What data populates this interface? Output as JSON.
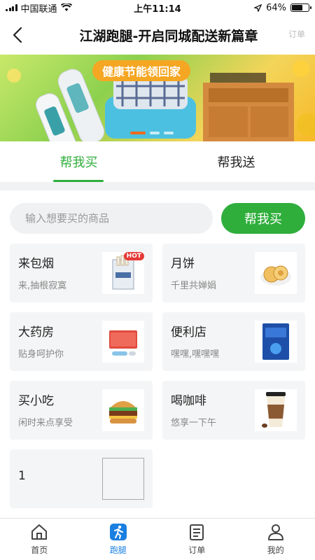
{
  "status": {
    "carrier": "中国联通",
    "time": "上午11:14",
    "battery": "64%",
    "battery_level": 0.64
  },
  "nav": {
    "title": "江湖跑腿-开启同城配送新篇章",
    "extra": "订单"
  },
  "banner": {
    "slogan": "健康节能领回家"
  },
  "tabs": [
    {
      "label": "帮我买"
    },
    {
      "label": "帮我送"
    }
  ],
  "search": {
    "placeholder": "输入想要买的商品",
    "value": "",
    "button_label": "帮我买"
  },
  "services": [
    {
      "title": "来包烟",
      "subtitle": "来,抽根寂寞",
      "icon": "cigarette-pack-image",
      "badge": "HOT"
    },
    {
      "title": "月饼",
      "subtitle": "千里共婵娟",
      "icon": "mooncake-image"
    },
    {
      "title": "大药房",
      "subtitle": "贴身呵护你",
      "icon": "medicine-image"
    },
    {
      "title": "便利店",
      "subtitle": "嘿嘿,嘿嘿嘿",
      "icon": "convenience-product-image"
    },
    {
      "title": "买小吃",
      "subtitle": "闲时来点享受",
      "icon": "burger-image"
    },
    {
      "title": "喝咖啡",
      "subtitle": "悠享一下午",
      "icon": "coffee-cup-image"
    },
    {
      "title": "1",
      "subtitle": "",
      "icon": "empty-image"
    }
  ],
  "bottom_tabs": [
    {
      "label": "首页",
      "icon": "home-icon"
    },
    {
      "label": "跑腿",
      "icon": "runner-icon"
    },
    {
      "label": "订单",
      "icon": "order-list-icon"
    },
    {
      "label": "我的",
      "icon": "profile-icon"
    }
  ],
  "colors": {
    "accent": "#2fae3b",
    "active_tab_bar": "#1a7fe0",
    "banner_pill": "#f5a623"
  }
}
